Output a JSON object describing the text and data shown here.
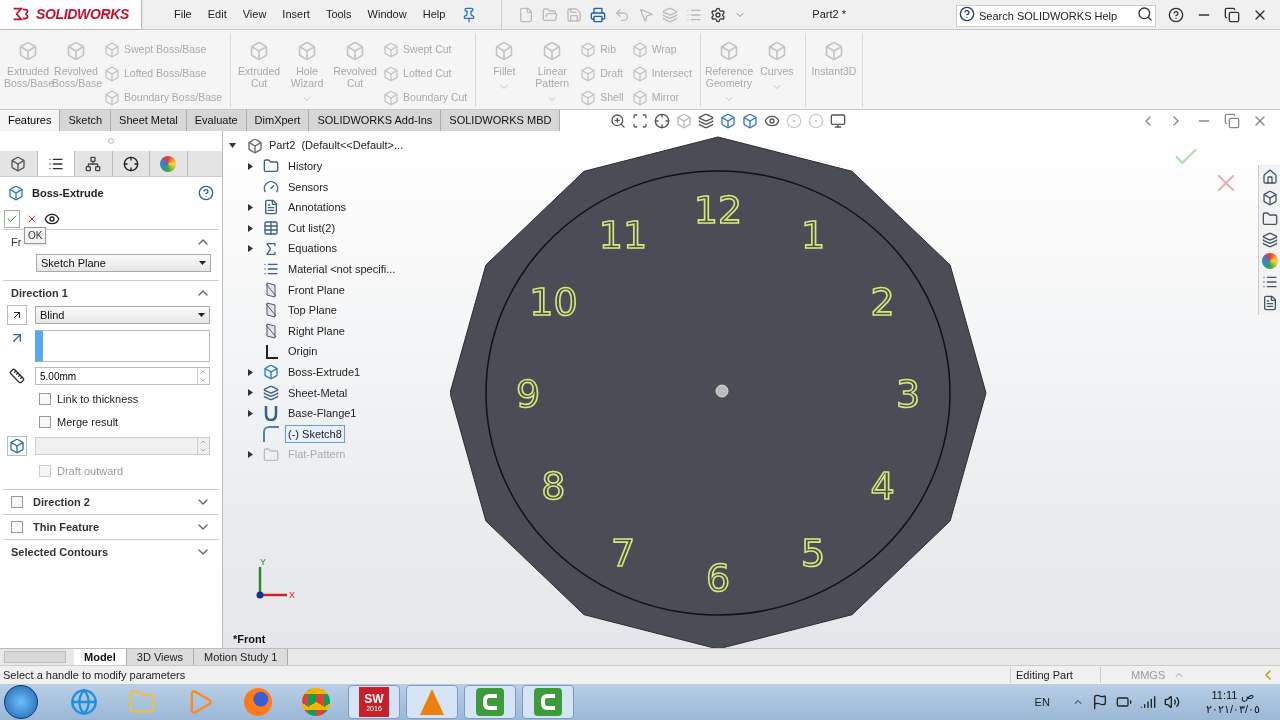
{
  "title_bar": {
    "logo": "SOLIDWORKS",
    "menu": [
      "File",
      "Edit",
      "View",
      "Insert",
      "Tools",
      "Window",
      "Help"
    ],
    "document_title": "Part2 *",
    "search": {
      "placeholder": "Search SOLIDWORKS Help"
    }
  },
  "ribbon": {
    "disabled": true,
    "groups": [
      {
        "columns": [
          {
            "kind": "large",
            "label": "Extruded Boss/Base"
          },
          {
            "kind": "large",
            "label": "Revolved Boss/Base"
          },
          {
            "kind": "stack",
            "items": [
              "Swept Boss/Base",
              "Lofted Boss/Base",
              "Boundary Boss/Base"
            ]
          }
        ]
      },
      {
        "columns": [
          {
            "kind": "large",
            "label": "Extruded Cut"
          },
          {
            "kind": "large",
            "label": "Hole Wizard",
            "dropdown": true
          },
          {
            "kind": "large",
            "label": "Revolved Cut"
          },
          {
            "kind": "stack",
            "items": [
              "Swept Cut",
              "Lofted Cut",
              "Boundary Cut"
            ]
          }
        ]
      },
      {
        "columns": [
          {
            "kind": "large",
            "label": "Fillet",
            "dropdown": true
          },
          {
            "kind": "large",
            "label": "Linear Pattern",
            "dropdown": true
          },
          {
            "kind": "stack",
            "items": [
              "Rib",
              "Draft",
              "Shell"
            ]
          },
          {
            "kind": "stack",
            "items": [
              "Wrap",
              "Intersect",
              "Mirror"
            ]
          }
        ]
      },
      {
        "columns": [
          {
            "kind": "large",
            "label": "Reference Geometry",
            "dropdown": true
          },
          {
            "kind": "large",
            "label": "Curves",
            "dropdown": true
          }
        ]
      },
      {
        "columns": [
          {
            "kind": "large",
            "label": "Instant3D"
          }
        ]
      }
    ]
  },
  "command_tabs": [
    {
      "label": "Features",
      "selected": true
    },
    {
      "label": "Sketch",
      "selected": false
    },
    {
      "label": "Sheet Metal",
      "selected": false
    },
    {
      "label": "Evaluate",
      "selected": false
    },
    {
      "label": "DimXpert",
      "selected": false
    },
    {
      "label": "SOLIDWORKS Add-Ins",
      "selected": false
    },
    {
      "label": "SOLIDWORKS MBD",
      "selected": false
    }
  ],
  "property_manager": {
    "panel_tabs": [
      {
        "kind": "tree",
        "selected": false
      },
      {
        "kind": "properties",
        "selected": true
      },
      {
        "kind": "config",
        "selected": false
      },
      {
        "kind": "dimxpert",
        "selected": false
      },
      {
        "kind": "display",
        "selected": false
      }
    ],
    "title": "Boss-Extrude",
    "tooltip": "OK",
    "sections": [
      {
        "kind": "from",
        "title": "Fr",
        "expanded": true,
        "start": "Sketch Plane"
      },
      {
        "kind": "direction",
        "title": "Direction 1",
        "expanded": true,
        "end_condition": "Blind",
        "depth": "5.00mm",
        "options": [
          {
            "label": "Link to thickness",
            "checked": false
          },
          {
            "label": "Merge result",
            "checked": false
          }
        ],
        "draft": {
          "label": "Draft outward",
          "checked": false,
          "disabled": true
        }
      },
      {
        "kind": "option",
        "title": "Direction 2",
        "checked": false,
        "expanded": false
      },
      {
        "kind": "option",
        "title": "Thin Feature",
        "checked": false,
        "expanded": false
      },
      {
        "kind": "plain",
        "title": "Selected Contours",
        "expanded": false
      }
    ]
  },
  "tree": {
    "label": "Part2  (Default<<Default>...",
    "expanded": true,
    "children": [
      {
        "label": "History",
        "kind": "folder",
        "expandable": true,
        "selected": false,
        "suppressed": false
      },
      {
        "label": "Sensors",
        "kind": "sensor",
        "expandable": false,
        "selected": false,
        "suppressed": false
      },
      {
        "label": "Annotations",
        "kind": "annotation",
        "expandable": true,
        "selected": false,
        "suppressed": false
      },
      {
        "label": "Cut list(2)",
        "kind": "cutlist",
        "expandable": true,
        "selected": false,
        "suppressed": false
      },
      {
        "label": "Equations",
        "kind": "equation",
        "expandable": true,
        "selected": false,
        "suppressed": false
      },
      {
        "label": "Material <not specifi...",
        "kind": "material",
        "expandable": false,
        "selected": false,
        "suppressed": false
      },
      {
        "label": "Front Plane",
        "kind": "plane",
        "expandable": false,
        "selected": false,
        "suppressed": false
      },
      {
        "label": "Top Plane",
        "kind": "plane",
        "expandable": false,
        "selected": false,
        "suppressed": false
      },
      {
        "label": "Right Plane",
        "kind": "plane",
        "expandable": false,
        "selected": false,
        "suppressed": false
      },
      {
        "label": "Origin",
        "kind": "origin",
        "expandable": false,
        "selected": false,
        "suppressed": false
      },
      {
        "label": "Boss-Extrude1",
        "kind": "feature",
        "expandable": true,
        "selected": false,
        "suppressed": false
      },
      {
        "label": "Sheet-Metal",
        "kind": "sheetmetal",
        "expandable": true,
        "selected": false,
        "suppressed": false
      },
      {
        "label": "Base-Flange1",
        "kind": "flange",
        "expandable": true,
        "selected": false,
        "suppressed": false
      },
      {
        "label": "(-) Sketch8",
        "kind": "sketch",
        "expandable": false,
        "selected": true,
        "suppressed": false
      },
      {
        "label": "Flat-Pattern",
        "kind": "folder",
        "expandable": true,
        "selected": false,
        "suppressed": true
      }
    ]
  },
  "viewport": {
    "view_name": "*Front",
    "triad": {
      "x": "X",
      "y": "Y"
    },
    "model": {
      "numbers": [
        "12",
        "1",
        "2",
        "3",
        "4",
        "5",
        "6",
        "7",
        "8",
        "9",
        "10",
        "11"
      ]
    }
  },
  "bottom_tabs": [
    {
      "label": "Model",
      "selected": true
    },
    {
      "label": "3D Views",
      "selected": false
    },
    {
      "label": "Motion Study 1",
      "selected": false
    }
  ],
  "status_bar": {
    "message": "Select a handle to modify parameters",
    "mode": "Editing Part",
    "units": "MMGS"
  },
  "taskbar": {
    "apps": [
      {
        "kind": "ie",
        "running": false
      },
      {
        "kind": "explorer",
        "running": false
      },
      {
        "kind": "media",
        "running": false
      },
      {
        "kind": "firefox",
        "running": false
      },
      {
        "kind": "chrome",
        "running": false
      },
      {
        "kind": "solidworks",
        "running": true,
        "label": "SW",
        "badge": "2016"
      },
      {
        "kind": "vlc",
        "running": true
      },
      {
        "kind": "camtasia",
        "running": true
      },
      {
        "kind": "camtasia",
        "running": true
      }
    ],
    "language": "EN",
    "time": "11:11",
    "period": "ص",
    "date": "٢٠٢١/٠٣/٠٥"
  }
}
